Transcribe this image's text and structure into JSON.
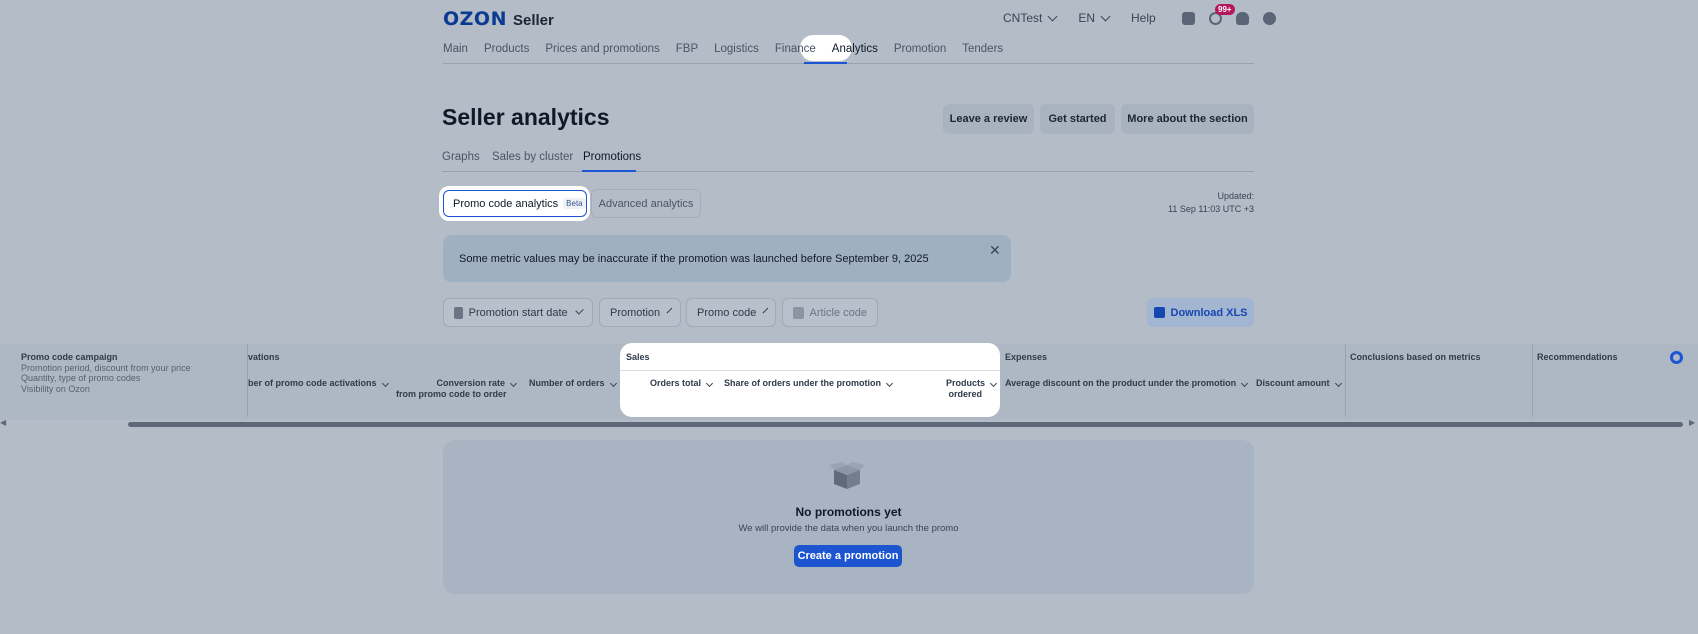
{
  "header": {
    "logo_brand": "OZON",
    "logo_product": "Seller",
    "account": "CNTest",
    "language": "EN",
    "help": "Help",
    "notifications_badge": "99+"
  },
  "nav": {
    "items": [
      "Main",
      "Products",
      "Prices and promotions",
      "FBP",
      "Logistics",
      "Finance",
      "Analytics",
      "Promotion",
      "Tenders"
    ],
    "active": "Analytics"
  },
  "page": {
    "title": "Seller analytics",
    "buttons": [
      "Leave a review",
      "Get started",
      "More about the section"
    ],
    "subtabs": [
      "Graphs",
      "Sales by cluster",
      "Promotions"
    ],
    "active_subtab": "Promotions"
  },
  "mode": {
    "active_label": "Promo code analytics",
    "beta": "Beta",
    "other_label": "Advanced analytics"
  },
  "updated": {
    "label": "Updated:",
    "value": "11 Sep 11:03 UTC +3"
  },
  "banner": {
    "text": "Some metric values may be inaccurate if the promotion was launched before September 9, 2025"
  },
  "filters": {
    "start_date": "Promotion start date",
    "promotion": "Promotion",
    "promo_code": "Promo code",
    "article_code": "Article code",
    "download": "Download XLS"
  },
  "table": {
    "campaign_title": "Promo code campaign",
    "campaign_lines": [
      "Promotion period, discount from your price",
      "Quantity, type of promo codes",
      "Visibility on Ozon"
    ],
    "groups": {
      "activations": "vations",
      "sales": "Sales",
      "expenses": "Expenses",
      "conclusions": "Conclusions based on metrics",
      "recommendations": "Recommendations"
    },
    "columns": {
      "activations_count": "ber of promo code activations",
      "conversion_1": "Conversion rate",
      "conversion_2": "from promo code to order",
      "orders_count": "Number of orders",
      "orders_total": "Orders total",
      "share_orders": "Share of orders under the promotion",
      "products_1": "Products",
      "products_2": "ordered",
      "avg_discount": "Average discount on the product under the promotion",
      "discount_amount": "Discount amount"
    }
  },
  "empty": {
    "title": "No promotions yet",
    "subtitle": "We will provide the data when you launch the promo",
    "button": "Create a promotion"
  },
  "colors": {
    "accent": "#1b55d6",
    "badge": "#b4175e",
    "overlay_bg": "#b3bcc7"
  }
}
